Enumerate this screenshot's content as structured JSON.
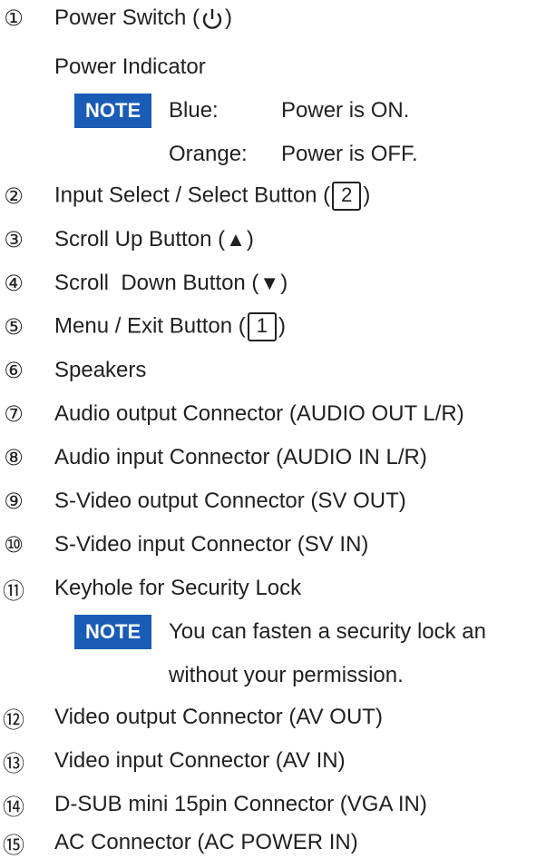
{
  "items": [
    {
      "num": "①",
      "label_pre": "Power Switch (",
      "label_post": ")",
      "icon": "power-icon"
    },
    {
      "num": "②",
      "label_pre": "Input Select / Select Button (",
      "key": "2",
      "label_post": ")"
    },
    {
      "num": "③",
      "label_pre": "Scroll Up Button (",
      "symbol": "▲",
      "label_post": ")"
    },
    {
      "num": "④",
      "label_pre": "Scroll  Down Button (",
      "symbol": "▼",
      "label_post": ")"
    },
    {
      "num": "⑤",
      "label_pre": "Menu / Exit Button (",
      "key": "1",
      "label_post": ")"
    },
    {
      "num": "⑥",
      "label": "Speakers"
    },
    {
      "num": "⑦",
      "label": "Audio output Connector (AUDIO OUT L/R)"
    },
    {
      "num": "⑧",
      "label": "Audio input Connector (AUDIO IN L/R)"
    },
    {
      "num": "⑨",
      "label": "S-Video output Connector (SV OUT)"
    },
    {
      "num": "⑩",
      "label": "S-Video input Connector (SV IN)"
    },
    {
      "num": "⑪",
      "label": "Keyhole for Security Lock"
    },
    {
      "num": "⑫",
      "label": "Video output Connector (AV OUT)"
    },
    {
      "num": "⑬",
      "label": "Video input Connector (AV IN)"
    },
    {
      "num": "⑭",
      "label": "D-SUB mini 15pin Connector (VGA IN)"
    },
    {
      "num": "⑮",
      "label": "AC Connector (AC POWER IN)"
    }
  ],
  "power_indicator": {
    "title": "Power Indicator",
    "note_label": "NOTE",
    "blue_key": "Blue:",
    "blue_value": "Power is ON.",
    "orange_key": "Orange:",
    "orange_value": "Power is OFF."
  },
  "security_note": {
    "note_label": "NOTE",
    "line1": "You can fasten a security lock an",
    "line2": "without your permission."
  },
  "colors": {
    "note_badge": "#1a5bb5",
    "text": "#231f20"
  }
}
